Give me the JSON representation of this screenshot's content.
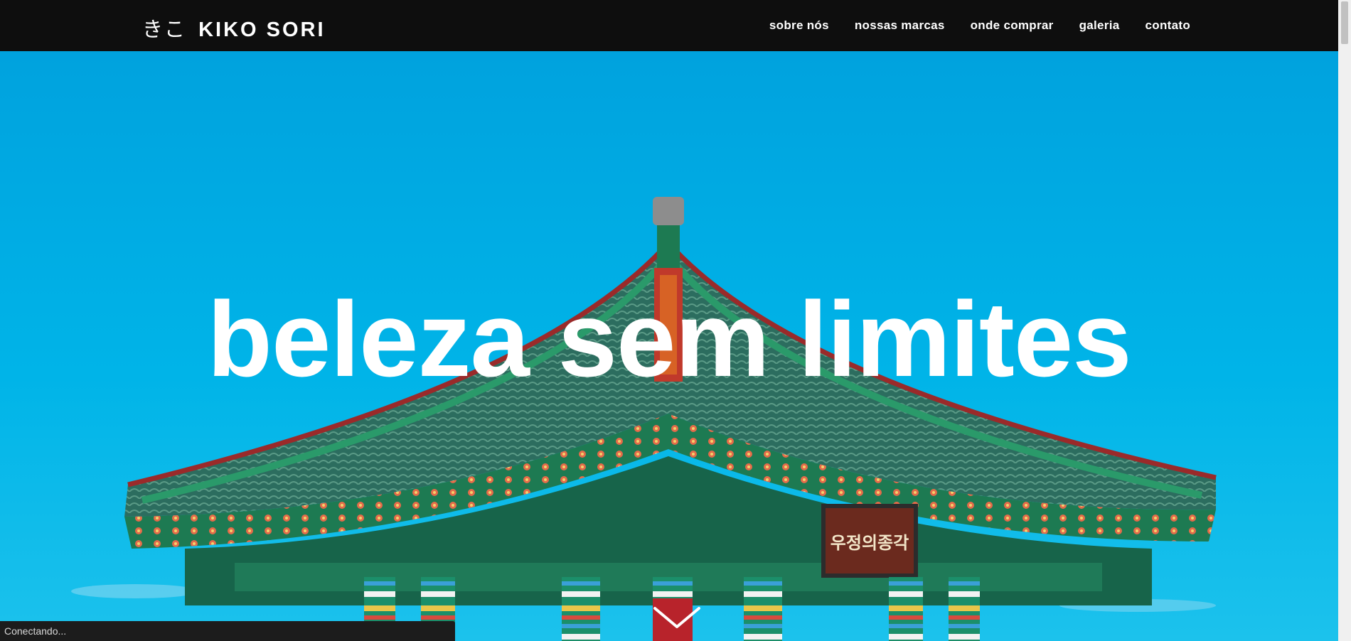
{
  "header": {
    "logo_kana": "きこ",
    "logo_text": "KIKO SORI",
    "nav": [
      {
        "label": "sobre nós"
      },
      {
        "label": "nossas marcas"
      },
      {
        "label": "onde comprar"
      },
      {
        "label": "galeria"
      },
      {
        "label": "contato"
      }
    ]
  },
  "hero": {
    "headline": "beleza sem limites",
    "signboard_text": "우정의종각",
    "scroll_icon": "chevron-down-icon"
  },
  "status_bar": {
    "text": "Conectando..."
  },
  "colors": {
    "navbar_bg": "#0e0e0e",
    "sky": "#00a8e2",
    "headline": "#ffffff",
    "roof_green": "#1f8a5e",
    "pillar_red": "#b8232b"
  }
}
